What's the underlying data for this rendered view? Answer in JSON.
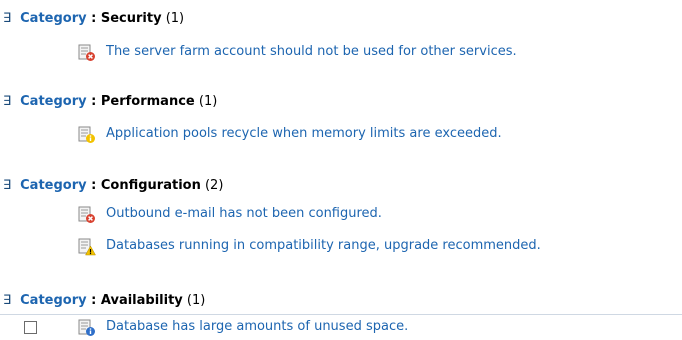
{
  "groups": [
    {
      "toggle": "∃",
      "category_label": "Category",
      "separator": " : ",
      "name": "Security",
      "count": "(1)",
      "rules": [
        {
          "text": "The server farm account should not be used for other services.",
          "icon": "error-document-icon"
        }
      ]
    },
    {
      "toggle": "∃",
      "category_label": "Category",
      "separator": " : ",
      "name": "Performance",
      "count": "(1)",
      "rules": [
        {
          "text": "Application pools recycle when memory limits are exceeded.",
          "icon": "info-document-icon"
        }
      ]
    },
    {
      "toggle": "∃",
      "category_label": "Category",
      "separator": " : ",
      "name": "Configuration",
      "count": "(2)",
      "rules": [
        {
          "text": "Outbound e-mail has not been configured.",
          "icon": "error-document-icon"
        },
        {
          "text": "Databases running in compatibility range, upgrade recommended.",
          "icon": "warning-document-icon"
        }
      ]
    },
    {
      "toggle": "∃",
      "category_label": "Category",
      "separator": " : ",
      "name": "Availability",
      "count": "(1)",
      "rules": [
        {
          "text": "Database has large amounts of unused space.",
          "icon": "info-document-icon"
        }
      ]
    }
  ],
  "colors": {
    "link": "#1d65b0",
    "error": "#d8412f",
    "warning": "#f2c200",
    "info": "#2f6fc9"
  }
}
